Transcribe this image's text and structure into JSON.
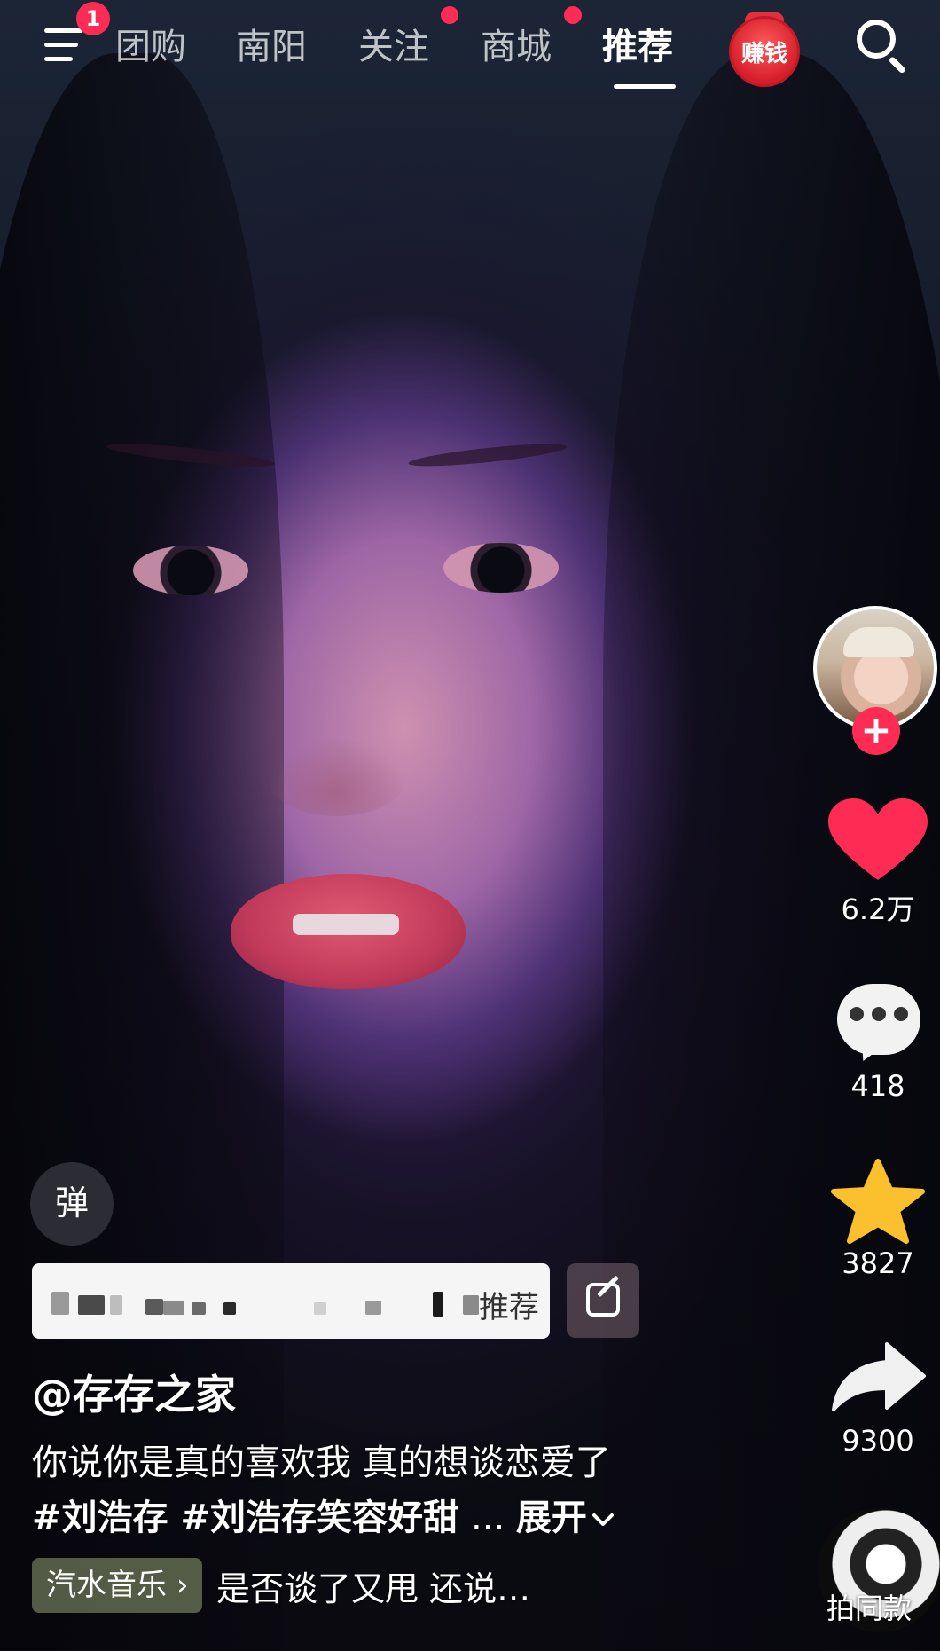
{
  "top_nav": {
    "menu_badge": "1",
    "tabs": [
      {
        "label": "团购",
        "active": false
      },
      {
        "label": "南阳",
        "active": false
      },
      {
        "label": "关注",
        "active": false,
        "dot": true
      },
      {
        "label": "商城",
        "active": false,
        "dot": true
      },
      {
        "label": "推荐",
        "active": true
      }
    ],
    "earn_label": "赚钱",
    "icons": {
      "menu": "menu-icon",
      "search": "search-icon"
    }
  },
  "actions": {
    "follow_plus": "+",
    "like_count": "6.2万",
    "comment_count": "418",
    "favorite_count": "3827",
    "share_count": "9300",
    "same_style_label": "拍同款"
  },
  "danmaku_label": "弹",
  "recommend_bar": {
    "label": "推荐"
  },
  "post": {
    "author": "@存存之家",
    "caption": "你说你是真的喜欢我 真的想谈恋爱了",
    "hashtags": [
      "#刘浩存",
      "#刘浩存笑容好甜"
    ],
    "ellipsis": "...",
    "expand": "展开"
  },
  "music": {
    "app_label": "汽水音乐",
    "chevron": "›",
    "track_text": "是否谈了又甩 还说…"
  },
  "colors": {
    "accent": "#fe2c55",
    "favorite": "#fbc02d"
  }
}
